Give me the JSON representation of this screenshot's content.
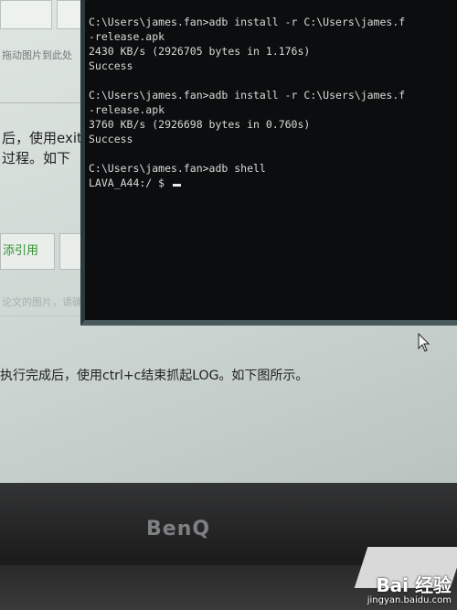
{
  "web_page": {
    "tab_hint_text": "拖动图片到此处",
    "paragraph_line1": "后，使用exiti",
    "paragraph_line2": "过程。如下",
    "cite_button_label": "添引用",
    "faint_text": "论文的图片，请确认",
    "bottom_text": "执行完成后，使用ctrl+c结束抓起LOG。如下图所示。"
  },
  "terminal": {
    "lines": [
      "C:\\Users\\james.fan>adb install -r C:\\Users\\james.f",
      "-release.apk",
      "2430 KB/s (2926705 bytes in 1.176s)",
      "Success",
      "",
      "C:\\Users\\james.fan>adb install -r C:\\Users\\james.f",
      "-release.apk",
      "3760 KB/s (2926698 bytes in 0.760s)",
      "Success",
      "",
      "C:\\Users\\james.fan>adb shell",
      "LAVA_A44:/ $ "
    ]
  },
  "monitor": {
    "brand": "BenQ"
  },
  "watermark": {
    "logo_text": "Bai 经验",
    "url": "jingyan.baidu.com"
  },
  "icons": {
    "pointer": "mouse-pointer-icon"
  }
}
